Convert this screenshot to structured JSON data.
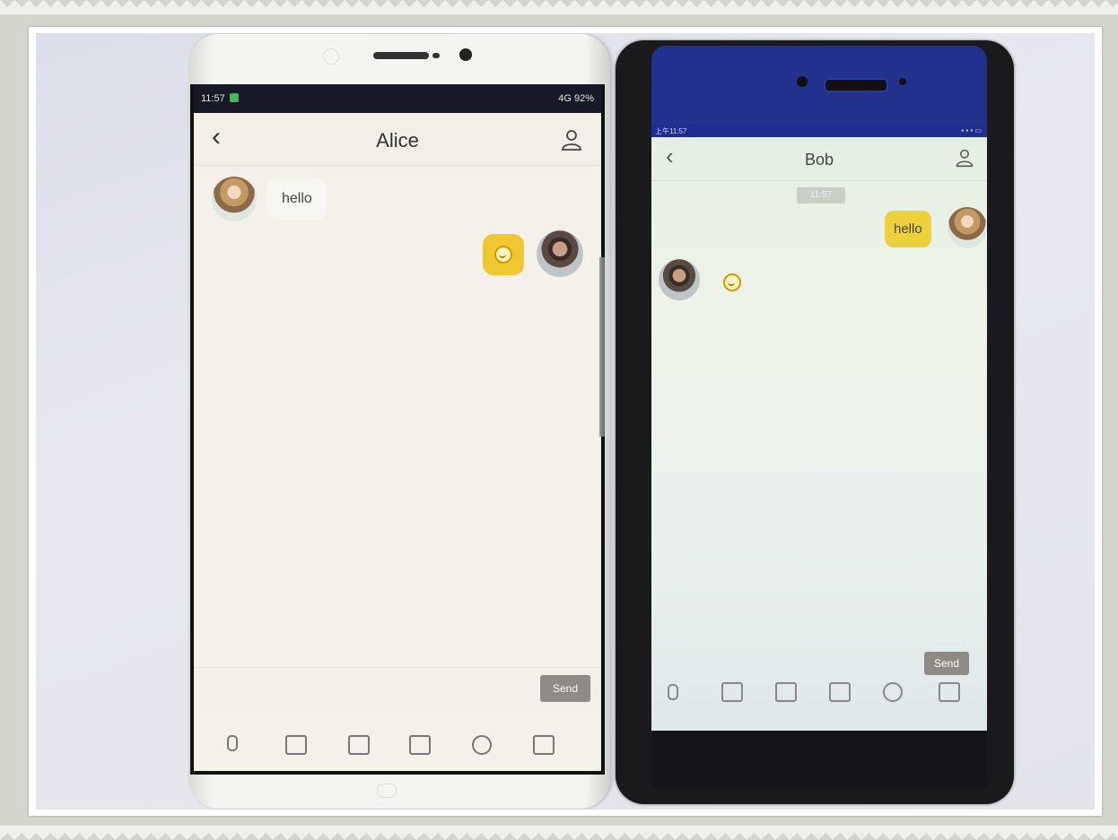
{
  "phone_left": {
    "status": {
      "time": "11:57",
      "right": "4G 92%"
    },
    "header": {
      "back_icon": "chevron-left",
      "title": "Alice",
      "contact_icon": "person-icon"
    },
    "messages": [
      {
        "from": "Alice",
        "type": "text",
        "text": "hello",
        "side": "left"
      },
      {
        "from": "me",
        "type": "emoji",
        "side": "right"
      }
    ],
    "composer": {
      "send_label": "Send"
    },
    "toolbar": [
      "mic-icon",
      "image-icon",
      "camera-icon",
      "contact-card-icon",
      "emoji-icon",
      "more-icon"
    ]
  },
  "phone_right": {
    "status": {
      "time": "上午11:57"
    },
    "header": {
      "back_icon": "chevron-left",
      "title": "Bob",
      "contact_icon": "person-icon"
    },
    "time_chip": "11:57",
    "messages": [
      {
        "from": "me",
        "type": "text",
        "text": "hello",
        "side": "right"
      },
      {
        "from": "Bob",
        "type": "emoji",
        "side": "left"
      }
    ],
    "composer": {
      "send_label": "Send"
    },
    "toolbar": [
      "mic-icon",
      "image-icon",
      "camera-icon",
      "contact-card-icon",
      "emoji-icon",
      "more-icon"
    ]
  },
  "colors": {
    "frame": "#d2d6cd",
    "bubble_yellow": "#f0c72e",
    "status_left": "#171927",
    "status_right": "#1e2d8e"
  }
}
